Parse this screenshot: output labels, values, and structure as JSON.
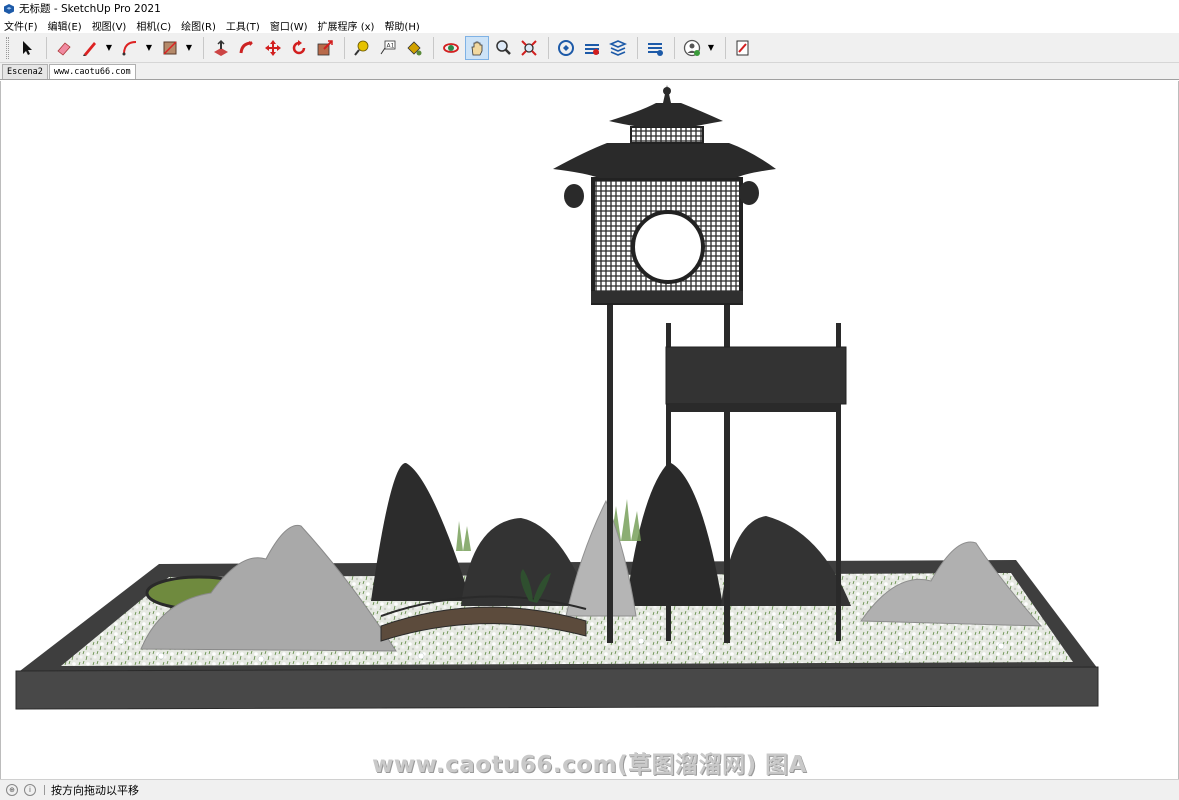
{
  "window": {
    "title": "无标题 - SketchUp Pro 2021",
    "app_icon": "sketchup-logo-icon"
  },
  "menu": [
    {
      "label": "文件(F)"
    },
    {
      "label": "编辑(E)"
    },
    {
      "label": "视图(V)"
    },
    {
      "label": "相机(C)"
    },
    {
      "label": "绘图(R)"
    },
    {
      "label": "工具(T)"
    },
    {
      "label": "窗口(W)"
    },
    {
      "label": "扩展程序 (x)"
    },
    {
      "label": "帮助(H)"
    }
  ],
  "toolbar": {
    "tools": [
      {
        "icon": "select-arrow-icon"
      },
      {
        "icon": "eraser-icon"
      },
      {
        "icon": "pencil-line-icon"
      },
      {
        "icon": "arc-icon"
      },
      {
        "icon": "rectangle-shape-icon"
      },
      {
        "icon": "push-pull-icon"
      },
      {
        "icon": "follow-me-icon"
      },
      {
        "icon": "move-icon"
      },
      {
        "icon": "rotate-icon"
      },
      {
        "icon": "scale-icon"
      },
      {
        "icon": "tape-measure-icon"
      },
      {
        "icon": "text-label-icon"
      },
      {
        "icon": "paint-bucket-icon"
      },
      {
        "icon": "orbit-icon"
      },
      {
        "icon": "pan-hand-icon"
      },
      {
        "icon": "zoom-icon"
      },
      {
        "icon": "zoom-extents-icon"
      },
      {
        "icon": "warehouse-icon"
      },
      {
        "icon": "extension-warehouse-icon"
      },
      {
        "icon": "layout-icon"
      },
      {
        "icon": "extension-manager-icon"
      },
      {
        "icon": "account-icon"
      },
      {
        "icon": "send-to-layout-icon"
      }
    ],
    "active_tool": "pan-hand-icon"
  },
  "scene_tabs": [
    {
      "label": "Escena2"
    },
    {
      "label": "www.caotu66.com"
    }
  ],
  "selected_tab": "www.caotu66.com",
  "viewport": {
    "watermark": "www.caotu66.com(草图溜溜网) 图A",
    "colors": {
      "tray": "#3e3e3e",
      "rock_gray": "#a9a9a9",
      "rock_dark": "#2c2c2c",
      "gravel": "#e9ece5",
      "grass": "#5f8a44"
    }
  },
  "status": {
    "icons": [
      "geo-location-icon",
      "info-icon"
    ],
    "text": "按方向拖动以平移"
  }
}
